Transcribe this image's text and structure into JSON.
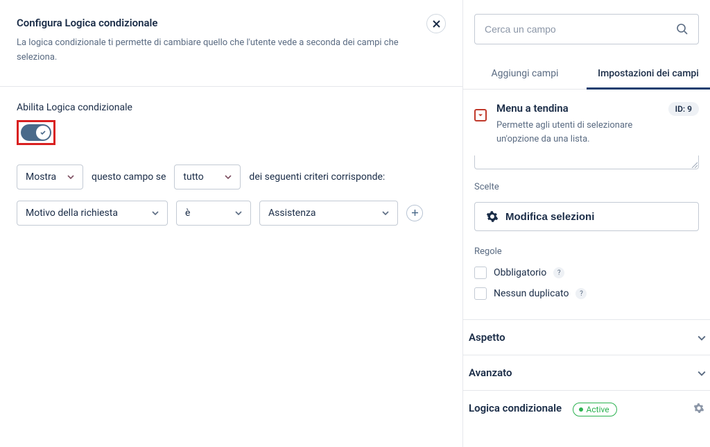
{
  "left": {
    "title": "Configura Logica condizionale",
    "description": "La logica condizionale ti permette di cambiare quello che l'utente vede a seconda dei campi che seleziona.",
    "enable_label": "Abilita Logica condizionale",
    "show_select": "Mostra",
    "this_field_if": "questo campo se",
    "match_select": "tutto",
    "criteria_text": "dei seguenti criteri corrisponde:",
    "rule_field": "Motivo della richiesta",
    "rule_op": "è",
    "rule_value": "Assistenza"
  },
  "right": {
    "search_placeholder": "Cerca un campo",
    "tab_add": "Aggiungi campi",
    "tab_settings": "Impostazioni dei campi",
    "field_title": "Menu a tendina",
    "field_desc": "Permette agli utenti di selezionare un'opzione da una lista.",
    "id_badge": "ID: 9",
    "choices_label": "Scelte",
    "edit_selections": "Modifica selezioni",
    "rules_label": "Regole",
    "rule_required": "Obbligatorio",
    "rule_nodup": "Nessun duplicato",
    "accordion_appearance": "Aspetto",
    "accordion_advanced": "Avanzato",
    "accordion_logic": "Logica condizionale",
    "active_badge": "Active"
  }
}
